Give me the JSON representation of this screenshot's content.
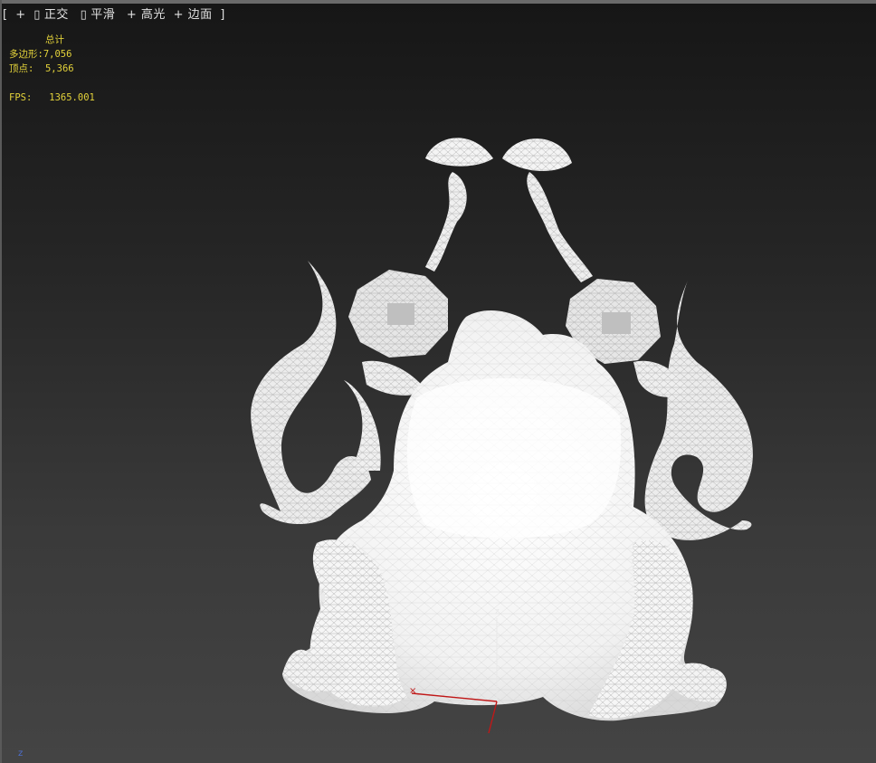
{
  "viewport_menu": {
    "bracket_open": "[",
    "plus": "+",
    "view_icon": "▯",
    "view": "正交",
    "shading_icon": "▯",
    "shading": "平滑",
    "highlight": "+ 高光",
    "edges": "+ 边面",
    "bracket_close": "]"
  },
  "stats": {
    "total_label": "总计",
    "polygons_label": "多边形:",
    "polygons_value": "7,056",
    "vertices_label": "顶点:",
    "vertices_value": "5,366",
    "fps_label": "FPS:",
    "fps_value": "1365.001"
  },
  "gizmo": {
    "z_label": "z"
  },
  "corner_axis": {
    "z_label": "z"
  },
  "colors": {
    "stats_text": "#e3d23a",
    "menu_text": "#e0e0e0",
    "axis_x": "#c01818",
    "axis_z_corner": "#4d6fd0"
  }
}
